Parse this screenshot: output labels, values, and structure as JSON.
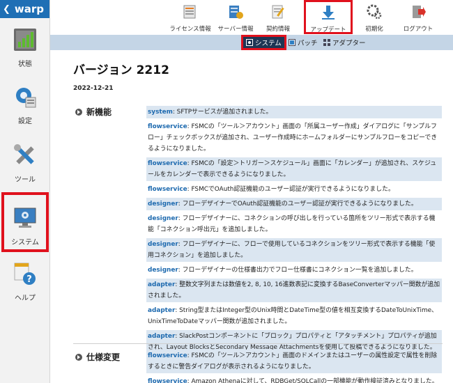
{
  "app": {
    "title": "warp"
  },
  "sidebar": {
    "items": [
      {
        "label": "状態"
      },
      {
        "label": "設定"
      },
      {
        "label": "ツール"
      },
      {
        "label": "システム"
      },
      {
        "label": "ヘルプ"
      }
    ]
  },
  "toolbar": {
    "items": [
      {
        "label": "ライセンス情報"
      },
      {
        "label": "サーバー情報"
      },
      {
        "label": "契約情報"
      },
      {
        "label": "アップデート"
      },
      {
        "label": "初期化"
      },
      {
        "label": "ログアウト"
      }
    ]
  },
  "subtabs": {
    "items": [
      {
        "label": "システム"
      },
      {
        "label": "パッチ"
      },
      {
        "label": "アダプター"
      }
    ]
  },
  "colors": {
    "brand": "#1f6fb5",
    "highlight": "#e0111d",
    "tag": "#1e6aaf",
    "row": "#dbe6f1"
  },
  "content": {
    "title": "バージョン 2212",
    "date": "2022-12-21",
    "sections": [
      {
        "heading": "新機能",
        "entries": [
          {
            "tag": "system",
            "text": ": SFTPサービスが追加されました。"
          },
          {
            "tag": "flowservice",
            "text": ": FSMCの「ツール＞アカウント」画面の「所属ユーザー作成」ダイアログに「サンプルフロー」チェックボックスが追加され、ユーザー作成時にホームフォルダーにサンプルフローをコピーできるようになりました。"
          },
          {
            "tag": "flowservice",
            "text": ": FSMCの「設定＞トリガー＞スケジュール」画面に「カレンダー」が追加され、スケジュールをカレンダーで表示できるようになりました。"
          },
          {
            "tag": "flowservice",
            "text": ": FSMCでOAuth認証機能のユーザー認証が実行できるようになりました。"
          },
          {
            "tag": "designer",
            "text": ": フローデザイナーでOAuth認証機能のユーザー認証が実行できるようになりました。"
          },
          {
            "tag": "designer",
            "text": ": フローデザイナーに、コネクションの呼び出しを行っている箇所をツリー形式で表示する機能「コネクション呼出元」を追加しました。"
          },
          {
            "tag": "designer",
            "text": ": フローデザイナーに、フローで使用しているコネクションをツリー形式で表示する機能「使用コネクション」を追加しました。"
          },
          {
            "tag": "designer",
            "text": ": フローデザイナーの仕様書出力でフロー仕様書にコネクション一覧を追加しました。"
          },
          {
            "tag": "adapter",
            "text": ": 整数文字列または数値を2, 8, 10, 16進数表記に変換するBaseConverterマッパー関数が追加されました。"
          },
          {
            "tag": "adapter",
            "text": ": String型またはInteger型のUnix時間とDateTime型の値を相互変換するDateToUnixTime、UnixTimeToDateマッパー関数が追加されました。"
          },
          {
            "tag": "adapter",
            "text": ": SlackPostコンポーネントに「ブロック」プロパティと「アタッチメント」プロパティが追加され、Layout BlocksとSecondary Message Attachmentsを使用して投稿できるようになりました。"
          }
        ]
      },
      {
        "heading": "仕様変更",
        "entries": [
          {
            "tag": "flowservice",
            "text": ": FSMCの「ツール＞アカウント」画面のドメインまたはユーザーの属性設定で属性を削除するときに警告ダイアログが表示されるようになりました。"
          },
          {
            "tag": "flowservice",
            "text": ": Amazon Athenaに対して、RDBGet/SQLCallの一部機能が動作検証済みとなりました。"
          }
        ]
      }
    ]
  }
}
